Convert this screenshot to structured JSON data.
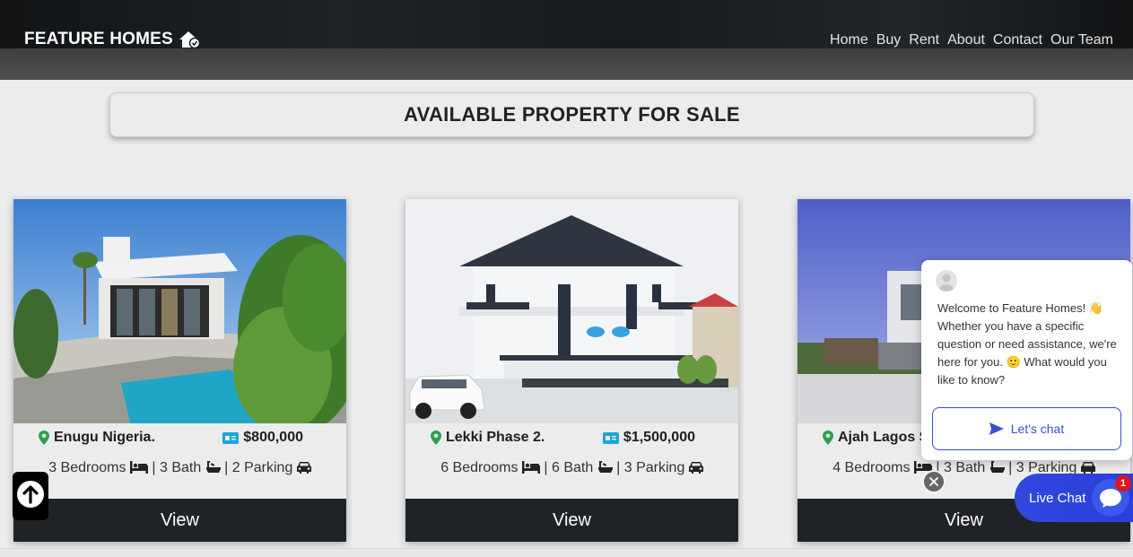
{
  "header": {
    "brand": "FEATURE HOMES",
    "nav": [
      "Home",
      "Buy",
      "Rent",
      "About",
      "Contact",
      "Our Team"
    ]
  },
  "page_title": "AVAILABLE PROPERTY FOR SALE",
  "listings": [
    {
      "location": "Enugu Nigeria.",
      "price": "$800,000",
      "bedrooms": "3 Bedrooms",
      "bath": "3 Bath",
      "parking": "2 Parking",
      "view_label": "View"
    },
    {
      "location": "Lekki Phase 2.",
      "price": "$1,500,000",
      "bedrooms": "6 Bedrooms",
      "bath": "6 Bath",
      "parking": "3 Parking",
      "view_label": "View"
    },
    {
      "location": "Ajah Lagos St",
      "price": "",
      "bedrooms": "4 Bedrooms",
      "bath": "3 Bath",
      "parking": "3 Parking",
      "view_label": "View"
    }
  ],
  "chat": {
    "welcome": "Welcome to Feature Homes! 👋 Whether you have a specific question or need assistance, we're here for you. 🙂 What would you like to know?",
    "cta": "Let's chat",
    "launcher_label": "Live Chat",
    "unread": "1"
  },
  "colors": {
    "accent": "#3048e0",
    "dark": "#202326",
    "pin": "#2e9e4e",
    "money": "#1aa6d8"
  },
  "icons": [
    "home-icon",
    "map-pin-icon",
    "money-icon",
    "bed-icon",
    "bath-icon",
    "car-icon",
    "arrow-up-icon",
    "send-icon",
    "close-icon",
    "chat-bubble-icon"
  ]
}
